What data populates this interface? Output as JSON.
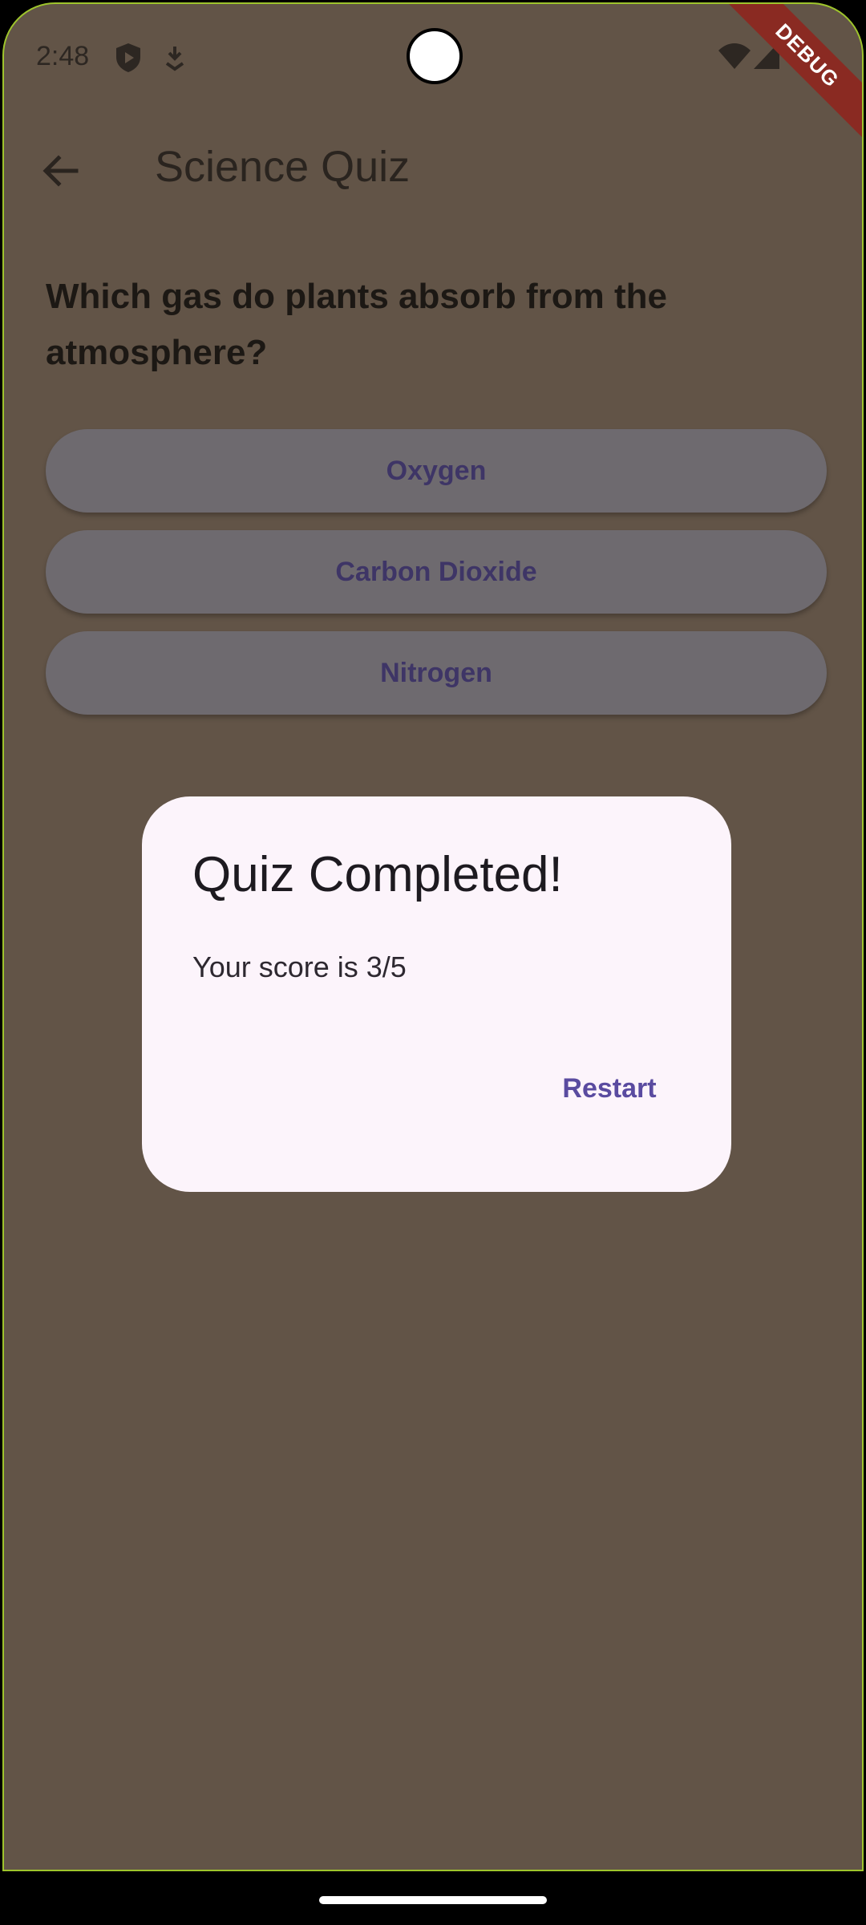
{
  "status_bar": {
    "time": "2:48",
    "icons": [
      "shield-play-icon",
      "download-icon",
      "wifi-icon",
      "signal-icon"
    ],
    "debug_label": "DEBUG"
  },
  "app_bar": {
    "back_icon": "arrow-back-icon",
    "title": "Science Quiz"
  },
  "question": "Which gas do plants absorb from the atmosphere?",
  "answers": [
    {
      "label": "Oxygen"
    },
    {
      "label": "Carbon Dioxide"
    },
    {
      "label": "Nitrogen"
    }
  ],
  "dialog": {
    "title": "Quiz Completed!",
    "body": "Your score is 3/5",
    "action": "Restart"
  },
  "colors": {
    "scrim_background": "#625447",
    "dialog_background": "#fcf4fb",
    "accent": "#5a4ba0",
    "answer_button": "#6e6a6f"
  }
}
